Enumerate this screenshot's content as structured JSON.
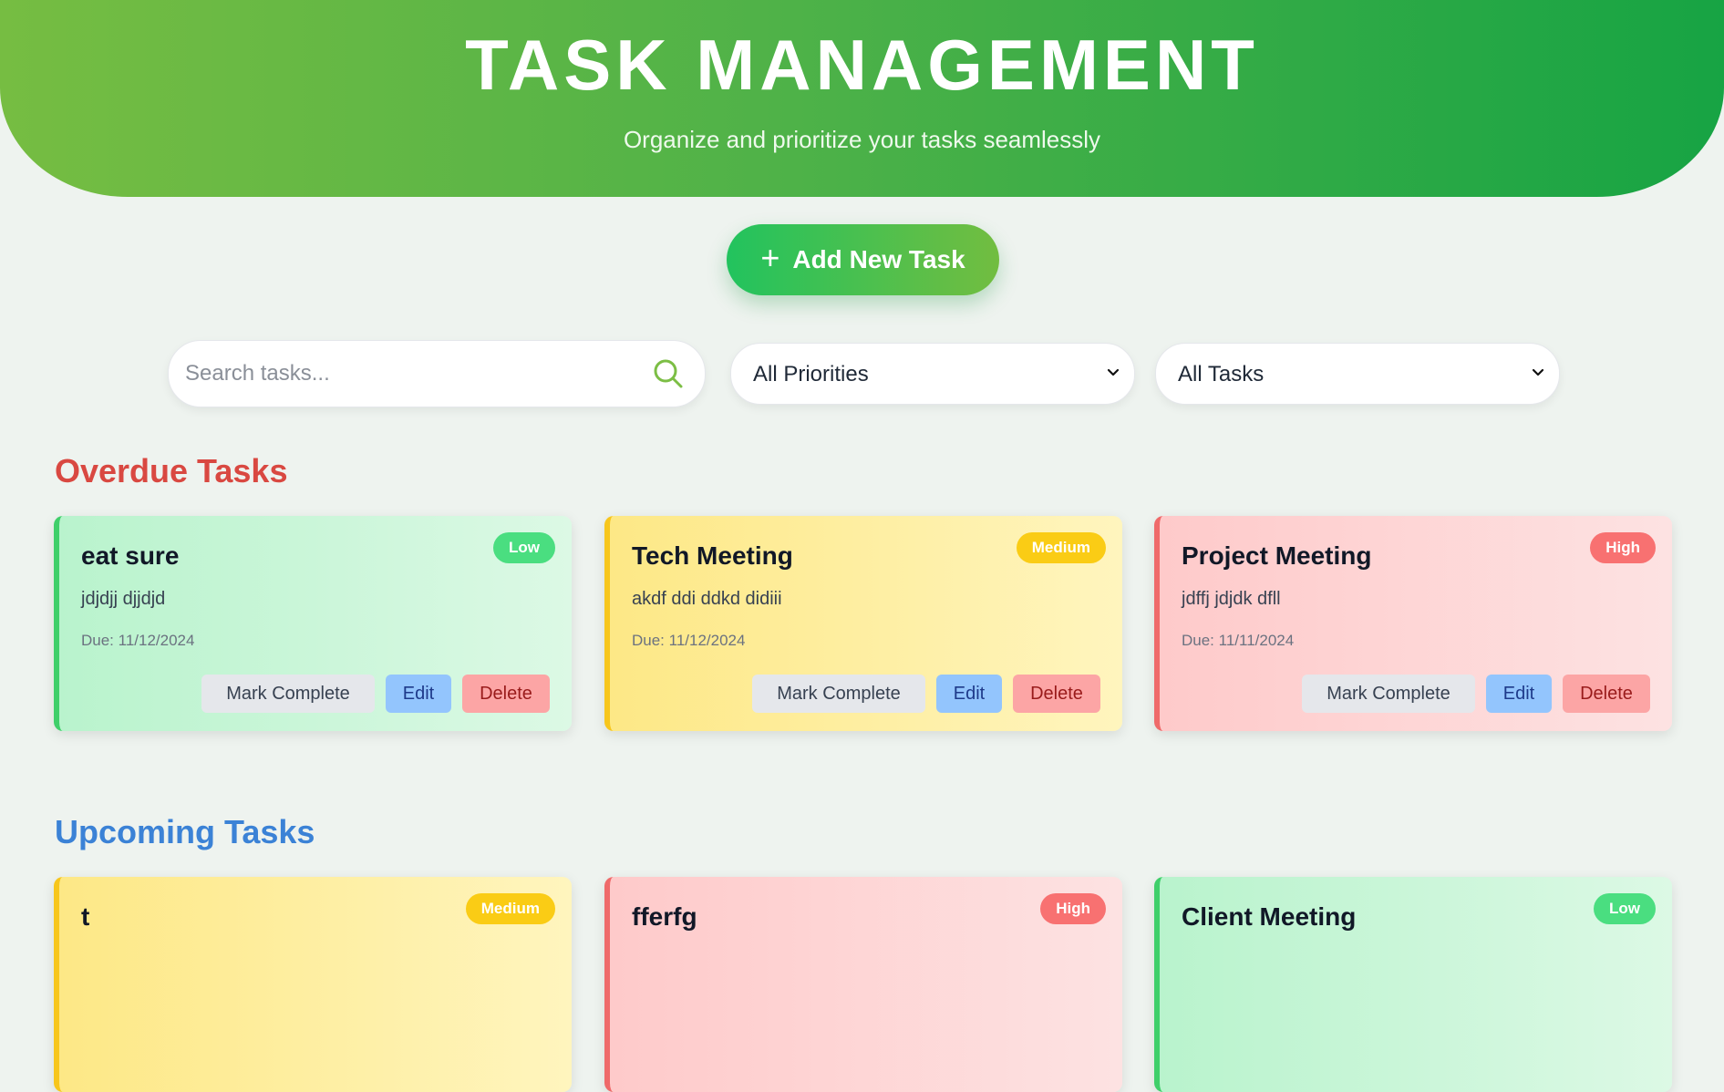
{
  "header": {
    "title": "TASK MANAGEMENT",
    "subtitle": "Organize and prioritize your tasks seamlessly"
  },
  "add_button": {
    "icon": "plus-icon",
    "label": "Add New Task"
  },
  "filters": {
    "search_placeholder": "Search tasks...",
    "search_icon": "search-icon",
    "priority_value": "All Priorities",
    "status_value": "All Tasks"
  },
  "colors": {
    "overdue": "#d94841",
    "upcoming": "#3b82d6",
    "low": "#4ade80",
    "medium": "#facc15",
    "high": "#f87171",
    "header_gradient_start": "#76bd42",
    "header_gradient_end": "#17a444"
  },
  "sections": {
    "overdue": {
      "title": "Overdue Tasks",
      "tasks": [
        {
          "title": "eat sure",
          "description": "jdjdjj djjdjd",
          "due": "Due: 11/12/2024",
          "priority": "Low"
        },
        {
          "title": "Tech Meeting",
          "description": "akdf ddi ddkd didiii",
          "due": "Due: 11/12/2024",
          "priority": "Medium"
        },
        {
          "title": "Project Meeting",
          "description": "jdffj jdjdk dfll",
          "due": "Due: 11/11/2024",
          "priority": "High"
        }
      ]
    },
    "upcoming": {
      "title": "Upcoming Tasks",
      "tasks": [
        {
          "title": "t",
          "priority": "Medium"
        },
        {
          "title": "fferfg",
          "priority": "High"
        },
        {
          "title": "Client Meeting",
          "priority": "Low"
        }
      ]
    }
  },
  "task_actions": {
    "complete": "Mark Complete",
    "edit": "Edit",
    "delete": "Delete"
  }
}
